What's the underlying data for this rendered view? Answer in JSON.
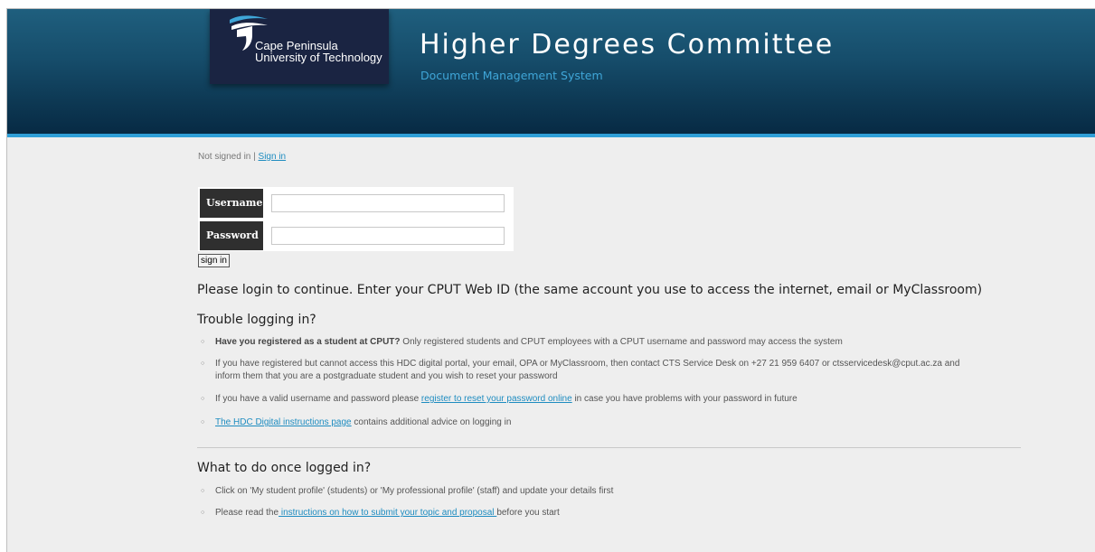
{
  "header": {
    "logo": {
      "line1": "Cape Peninsula",
      "line2": "University of Technology"
    },
    "title": "Higher Degrees Committee",
    "subtitle": "Document Management System",
    "colors": {
      "header_top": "#1f5f7e",
      "header_bottom": "#072a44",
      "accent_bar": "#2f9fd7",
      "logo_bg": "#1a2442"
    }
  },
  "status": {
    "text": "Not signed in | ",
    "link": "Sign in"
  },
  "login": {
    "username_label": "Username",
    "username_value": "",
    "password_label": "Password",
    "password_value": "",
    "submit_label": "sign in"
  },
  "instructions": "Please login to continue. Enter your CPUT Web ID (the same account you use to access the internet, email or MyClassroom)",
  "trouble": {
    "heading": "Trouble logging in?",
    "b1_bold": "Have you registered as a student at CPUT?",
    "b1_rest": " Only registered students and CPUT employees with a CPUT username and password may access the system",
    "b2_line1": "If you have registered but cannot access this HDC digital portal, your email, OPA or MyClassroom, then contact CTS Service Desk on +27 21 959 6407 or ctsservicedesk@cput.ac.za and",
    "b2_line2": "inform them that you are a postgraduate student and you wish to reset your password",
    "b3_pre": "If you have a valid username and password please ",
    "b3_link": "register to reset your password online",
    "b3_post": " in case you have problems with your password in future",
    "b4_link": "The HDC Digital instructions page",
    "b4_post": " contains additional advice on logging in"
  },
  "after": {
    "heading": "What to do once logged in?",
    "b1": "Click on 'My student profile' (students) or 'My professional profile' (staff) and update your details first",
    "b2_pre": "Please read the",
    "b2_link": " instructions on how to submit your topic and proposal ",
    "b2_post": "before you start"
  }
}
